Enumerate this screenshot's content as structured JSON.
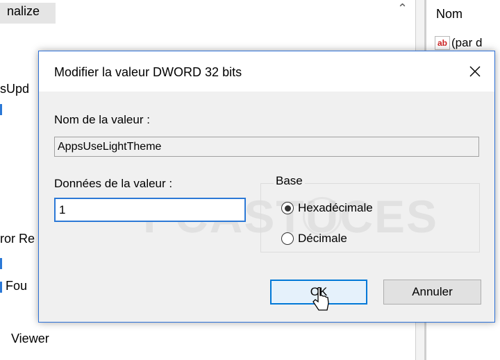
{
  "background": {
    "tree_items": [
      {
        "label": "nalize"
      },
      {
        "label": "sUpd"
      },
      {
        "label": "ror Re"
      },
      {
        "label": "Fou"
      },
      {
        "label": "Viewer"
      }
    ],
    "list_header": "Nom",
    "list_row": "(par d",
    "list_row_icon": "ab"
  },
  "dialog": {
    "title": "Modifier la valeur DWORD 32 bits",
    "name_label": "Nom de la valeur :",
    "name_value": "AppsUseLightTheme",
    "data_label": "Données de la valeur :",
    "data_value": "1",
    "base_label": "Base",
    "radio_hex": "Hexadécimale",
    "radio_dec": "Décimale",
    "selected_base": "Hexadécimale",
    "ok_label": "OK",
    "cancel_label": "Annuler"
  },
  "watermark": "PCASTUCES",
  "colors": {
    "accent": "#0078d7",
    "dialog_bg": "#f0f0f0"
  }
}
